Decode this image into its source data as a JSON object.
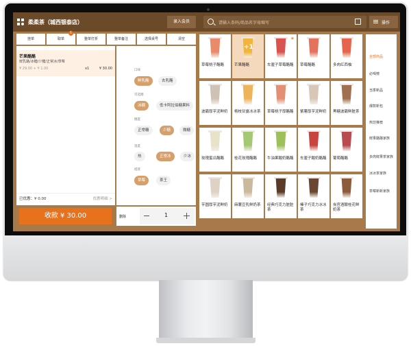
{
  "header": {
    "store_name": "柔柔茶（城西银泰店）",
    "member_button": "录入会员",
    "search_placeholder": "请输入条码/商品名字母缩写",
    "ops_button": "操作"
  },
  "tabs": [
    {
      "label": "挂单"
    },
    {
      "label": "取单",
      "badge": "1"
    },
    {
      "label": "整单打折"
    },
    {
      "label": "整单备注"
    },
    {
      "label": "选择桌号"
    },
    {
      "label": "清空"
    }
  ],
  "order": {
    "item_name": "芒果酪酪",
    "item_spec": "鲜乳酪/冰糖/少糖/正常冰/草莓",
    "item_price": "¥ 29.00 + ¥ 1.00",
    "item_qty": "x1",
    "item_total": "¥ 30.00",
    "discount_label": "已优惠：¥ 0.00",
    "discount_link": "优惠明细 >",
    "checkout_label": "收款 ¥ 30.00",
    "delete_label": "删除",
    "quantity": "1"
  },
  "spec_groups": [
    {
      "title": "口味",
      "options": [
        {
          "label": "鲜乳酪",
          "selected": true
        },
        {
          "label": "去乳酪",
          "selected": false
        }
      ]
    },
    {
      "title": "可选糖",
      "options": [
        {
          "label": "冰糖",
          "selected": true
        },
        {
          "label": "低卡阿拉伯糖果料",
          "selected": false
        }
      ]
    },
    {
      "title": "糖度",
      "options": [
        {
          "label": "正常糖",
          "selected": false
        },
        {
          "label": "少糖",
          "selected": true
        },
        {
          "label": "微糖",
          "selected": false
        }
      ]
    },
    {
      "title": "温度",
      "options": [
        {
          "label": "热",
          "selected": false
        },
        {
          "label": "正常冰",
          "selected": true
        },
        {
          "label": "少冰",
          "selected": false
        }
      ]
    },
    {
      "title": "搭底",
      "options": [
        {
          "label": "草莓",
          "selected": true
        },
        {
          "label": "茶王",
          "selected": false
        }
      ]
    }
  ],
  "products": [
    {
      "name": "草莓桃子酪酪",
      "color": "#e98a6a"
    },
    {
      "name": "芒果酪酪",
      "color": "#f2b43c",
      "selected": true,
      "plus": "+1"
    },
    {
      "name": "车厘子草莓酪酪",
      "color": "#d9534f",
      "star": true
    },
    {
      "name": "草莓酪酪",
      "color": "#e4735e"
    },
    {
      "name": "多肉红西柚",
      "color": "#e5664d"
    },
    {
      "name": "波霸厚芋泥鲜奶",
      "color": "#cfc2b5"
    },
    {
      "name": "杨枝甘露冰冰茶",
      "color": "#efb45a"
    },
    {
      "name": "草莓桃子厚酪酪",
      "color": "#e28f73"
    },
    {
      "name": "紫薯厚芋泥鲜奶",
      "color": "#d8c7b8"
    },
    {
      "name": "黑糖波霸鲜脏茶",
      "color": "#a07050"
    },
    {
      "name": "玫瑰蜜瓜酪酪",
      "color": "#e8e2c8"
    },
    {
      "name": "桂花玫瑰酪酪",
      "color": "#a5c875"
    },
    {
      "name": "牛油果酸奶酪酪",
      "color": "#9dc05a"
    },
    {
      "name": "车厘子酸奶酪酪",
      "color": "#c9433f"
    },
    {
      "name": "葡萄酪酪",
      "color": "#b84a50"
    },
    {
      "name": "芋圆厚芋泥鲜奶",
      "color": "#ddd2c4"
    },
    {
      "name": "麻薯豆乳鲜奶茶",
      "color": "#cbb99e"
    },
    {
      "name": "经典巧克力脏脏茶",
      "color": "#5a3a28"
    },
    {
      "name": "榛子巧克力冰冰茶",
      "color": "#6b4632"
    },
    {
      "name": "炭官酒酿桂花鲜奶茶",
      "color": "#8c5a3c"
    }
  ],
  "categories": [
    {
      "label": "全部商品",
      "selected": true
    },
    {
      "label": "必喝榜"
    },
    {
      "label": "当季新品"
    },
    {
      "label": "爆款新包"
    },
    {
      "label": "热饮推荐"
    },
    {
      "label": "鲜果酪酪家族"
    },
    {
      "label": "多肉鲜果茶家族"
    },
    {
      "label": "冰冰茶家族"
    },
    {
      "label": "草莓新新家族"
    }
  ]
}
